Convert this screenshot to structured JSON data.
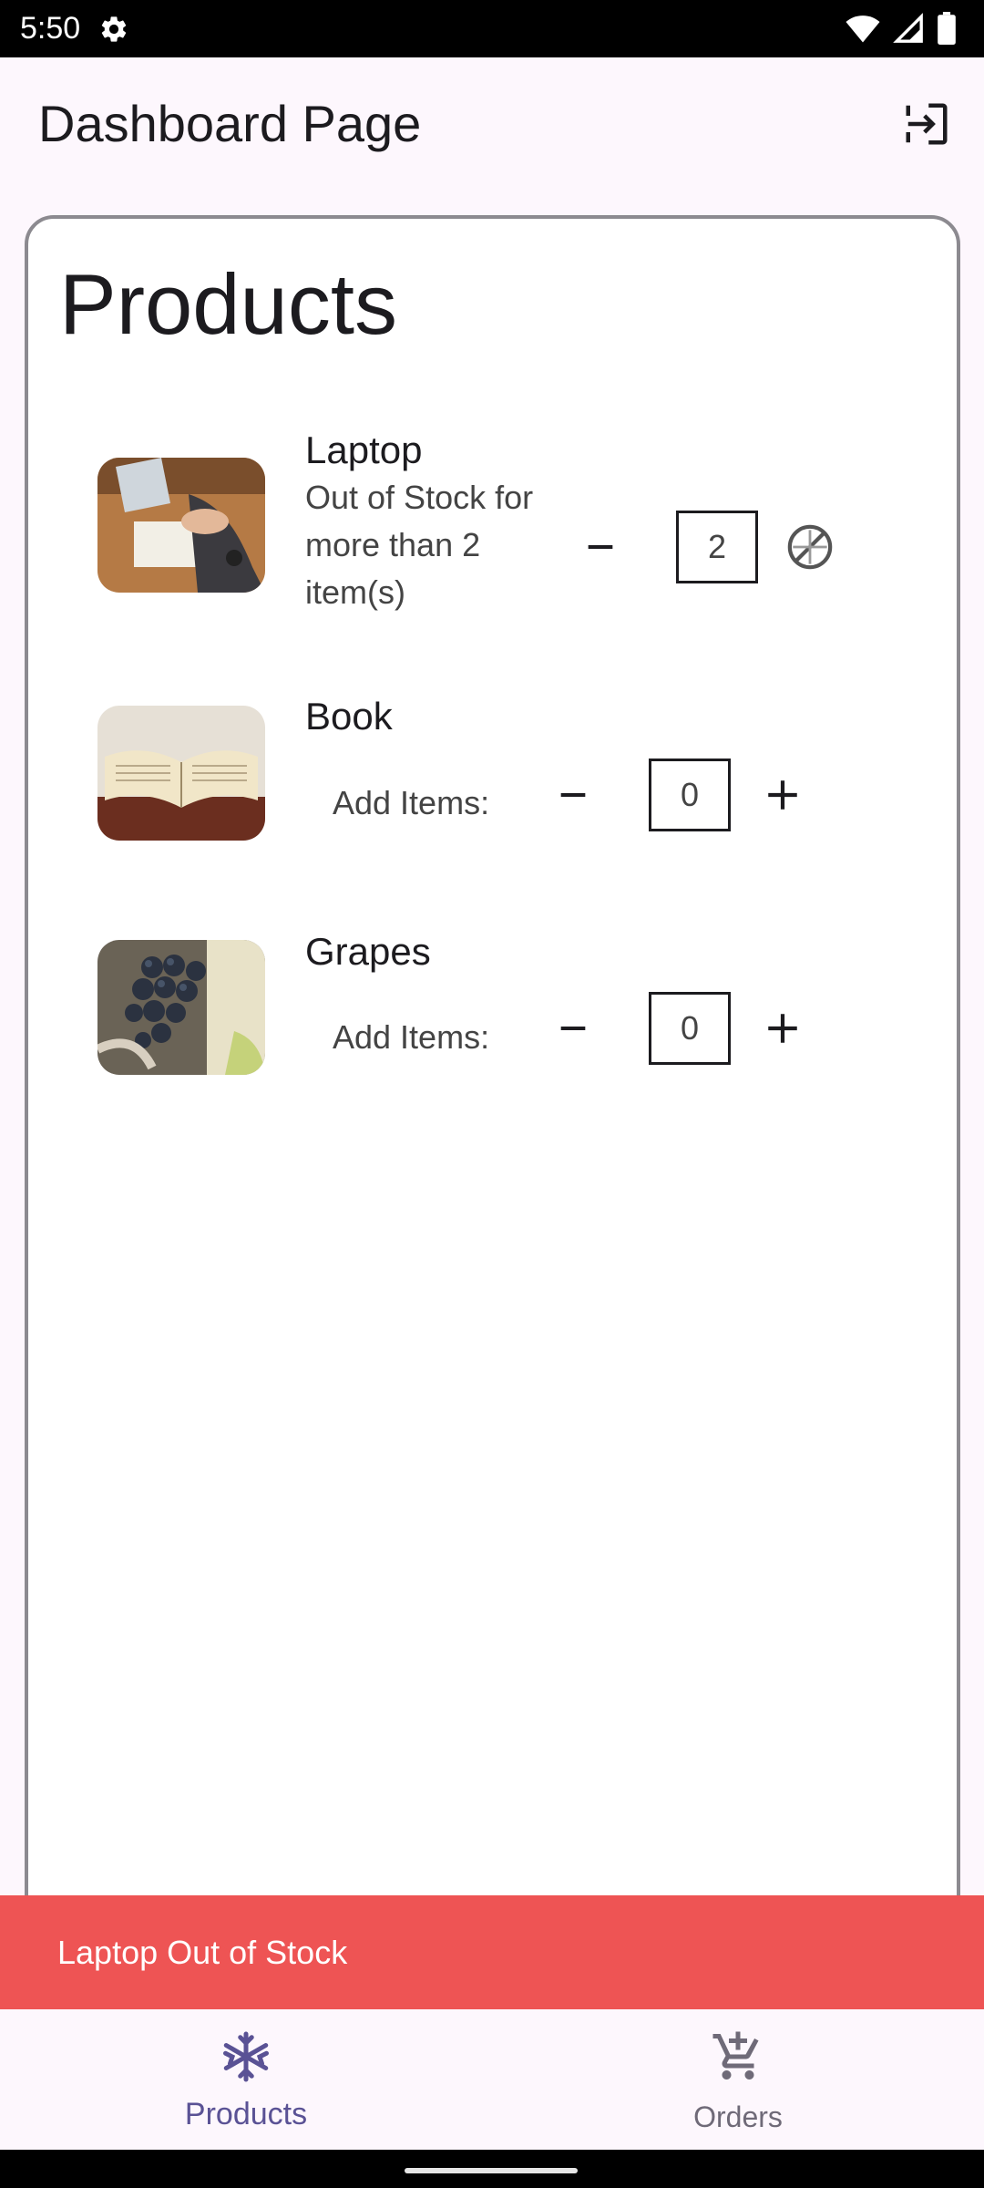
{
  "status_bar": {
    "time": "5:50"
  },
  "app_bar": {
    "title": "Dashboard Page",
    "logout_icon": "logout-icon"
  },
  "card": {
    "title": "Products",
    "products": [
      {
        "name": "Laptop",
        "note": "Out of Stock for more than 2 item(s)",
        "quantity": "2",
        "add_disabled": true
      },
      {
        "name": "Book",
        "add_label": "Add Items:",
        "quantity": "0"
      },
      {
        "name": "Grapes",
        "add_label": "Add Items:",
        "quantity": "0"
      }
    ]
  },
  "snackbar": {
    "message": "Laptop Out of Stock",
    "color": "#ee5454"
  },
  "bottom_nav": {
    "items": [
      {
        "label": "Products",
        "icon": "snowflake-icon",
        "active": true
      },
      {
        "label": "Orders",
        "icon": "cart-add-icon",
        "active": false
      }
    ],
    "accent": "#5a5295"
  }
}
